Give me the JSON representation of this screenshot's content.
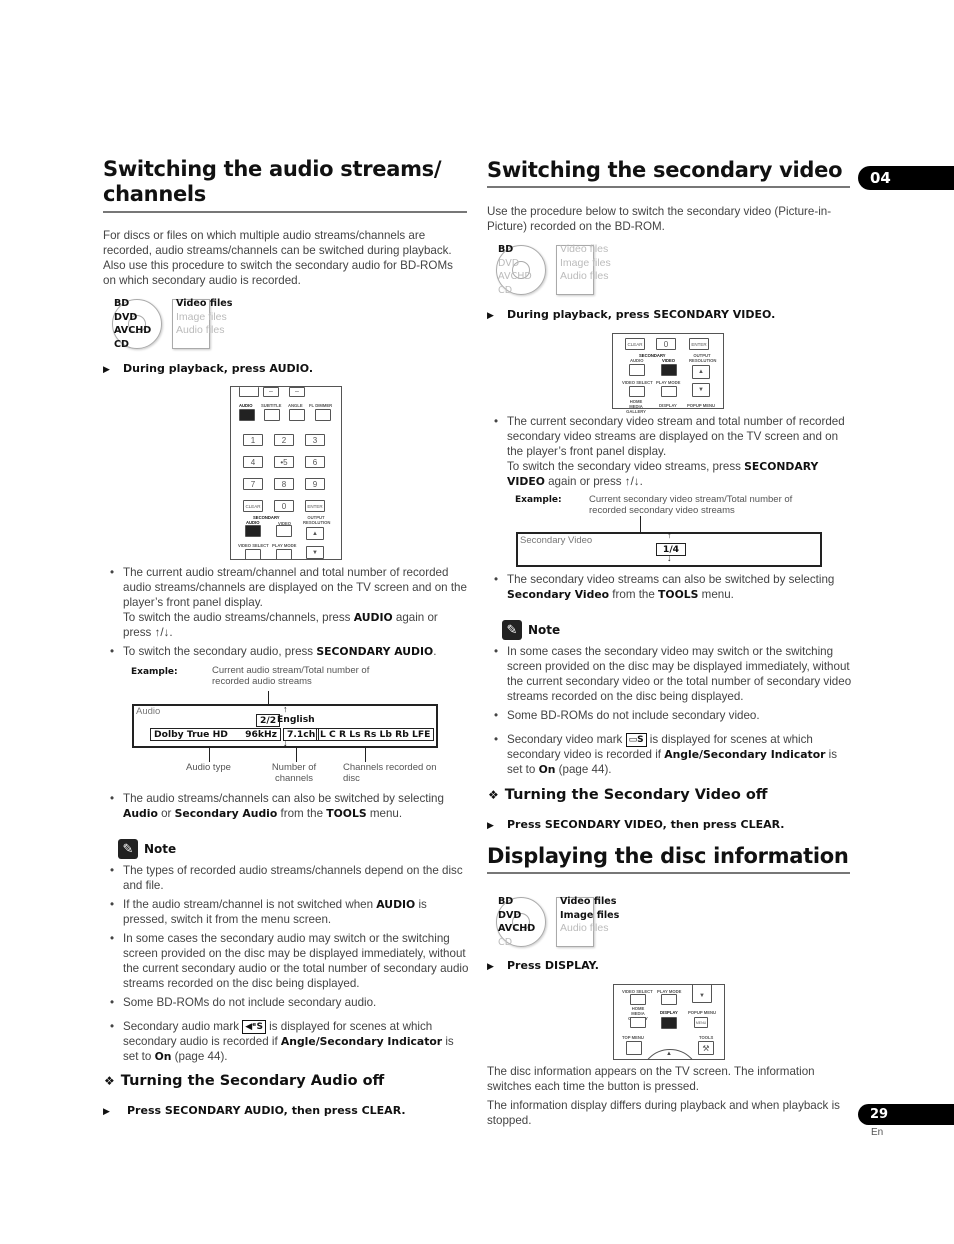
{
  "chapter": "04",
  "page": {
    "number": "29",
    "lang": "En"
  },
  "left": {
    "title_line1": "Switching the audio streams/",
    "title_line2": "channels",
    "intro": "For discs or files on which multiple audio streams/channels are recorded, audio streams/channels can be switched during playback. Also use this procedure to switch the secondary audio for BD-ROMs on which secondary audio is recorded.",
    "media": {
      "discs": [
        {
          "label": "BD",
          "supported": true
        },
        {
          "label": "DVD",
          "supported": true
        },
        {
          "label": "AVCHD",
          "supported": true
        },
        {
          "label": "CD",
          "supported": true
        }
      ],
      "files": [
        {
          "label": "Video files",
          "supported": true
        },
        {
          "label": "Image files",
          "supported": false
        },
        {
          "label": "Audio files",
          "supported": false
        }
      ]
    },
    "step": "During playback, press AUDIO.",
    "remote": {
      "top_labels": [
        "AUDIO",
        "SUBTITLE",
        "ANGLE",
        "FL DIMMER"
      ],
      "digits": [
        "1",
        "2",
        "3",
        "4",
        "•5",
        "6",
        "7",
        "8",
        "9"
      ],
      "clear": "CLEAR",
      "zero": "0",
      "enter": "ENTER",
      "secondary": "SECONDARY",
      "sec_audio": "AUDIO",
      "sec_video": "VIDEO",
      "output_res": "OUTPUT RESOLUTION",
      "video_select": "VIDEO SELECT",
      "play_mode": "PLAY MODE",
      "dash": "–",
      "up": "▲",
      "down": "▼"
    },
    "bullets1": [
      {
        "pre": "The current audio stream/channel and total number of recorded audio streams/channels are displayed on the TV screen and on the player’s front panel display.",
        "line2_pre": "To switch the audio streams/channels, press ",
        "line2_b": "AUDIO",
        "line2_post": " again or press ↑/↓."
      },
      {
        "pre": "To switch the secondary audio, press ",
        "b": "SECONDARY AUDIO",
        "post": "."
      }
    ],
    "example": {
      "label": "Example:",
      "caption": "Current audio stream/Total number of recorded audio streams",
      "osd_title": "Audio",
      "stream": "2/2",
      "language": "English",
      "audio_type": "Dolby True HD",
      "rate": "96kHz",
      "channels": "7.1ch",
      "channel_list": "L C R Ls Rs Lb Rb LFE",
      "cap_type": "Audio type",
      "cap_num": "Number of channels",
      "cap_rec": "Channels recorded on disc"
    },
    "bullet2": {
      "pre": "The audio streams/channels can also be switched by selecting ",
      "b1": "Audio",
      "mid1": " or ",
      "b2": "Secondary Audio",
      "mid2": " from the ",
      "b3": "TOOLS",
      "post": " menu."
    },
    "note": {
      "heading": "Note",
      "items": [
        {
          "text": "The types of recorded audio streams/channels depend on the disc and file."
        },
        {
          "pre": "If the audio stream/channel is not switched when ",
          "b": "AUDIO",
          "post": " is pressed, switch it from the menu screen."
        },
        {
          "text": "In some cases the secondary audio may switch or the switching screen provided on the disc may be displayed immediately, without the current secondary audio or the total number of secondary audio streams recorded on the disc being displayed."
        },
        {
          "text": "Some BD-ROMs do not include secondary audio."
        },
        {
          "pre": "Secondary audio mark ",
          "mark": "◀ᵉS",
          "mid": " is displayed for scenes at which secondary audio is recorded if ",
          "b": "Angle/Secondary Indicator",
          "mid2": " is set to ",
          "b2": "On",
          "post": " (page 44)."
        }
      ]
    },
    "sub_heading": "Turning the Secondary Audio off",
    "sub_step": "Press SECONDARY AUDIO, then press CLEAR."
  },
  "right": {
    "title": "Switching the secondary video",
    "intro": "Use the procedure below to switch the secondary video (Picture-in-Picture) recorded on the BD-ROM.",
    "media": {
      "discs": [
        {
          "label": "BD",
          "supported": true
        },
        {
          "label": "DVD",
          "supported": false
        },
        {
          "label": "AVCHD",
          "supported": false
        },
        {
          "label": "CD",
          "supported": false
        }
      ],
      "files": [
        {
          "label": "Video files",
          "supported": false
        },
        {
          "label": "Image files",
          "supported": false
        },
        {
          "label": "Audio files",
          "supported": false
        }
      ]
    },
    "step": "During playback, press SECONDARY VIDEO.",
    "remote": {
      "clear": "CLEAR",
      "zero": "0",
      "enter": "ENTER",
      "secondary": "SECONDARY",
      "sec_audio": "AUDIO",
      "sec_video": "VIDEO",
      "output_res": "OUTPUT RESOLUTION",
      "video_select": "VIDEO SELECT",
      "play_mode": "PLAY MODE",
      "home_media": "HOME MEDIA GALLERY",
      "display": "DISPLAY",
      "popup": "POPUP MENU",
      "up": "▲",
      "down": "▼"
    },
    "bullet1": {
      "pre": "The current secondary video stream and total number of recorded secondary video streams are displayed on the TV screen and on the player’s front panel display.",
      "line2_pre": "To switch the secondary video streams, press ",
      "line2_b": "SECONDARY VIDEO",
      "line2_post": " again or press ↑/↓."
    },
    "example": {
      "label": "Example:",
      "caption": "Current secondary video stream/Total number of recorded secondary video streams",
      "osd_title": "Secondary Video",
      "stream": "1/4"
    },
    "bullet2": {
      "pre": "The secondary video streams can also be switched by selecting ",
      "b1": "Secondary Video",
      "mid": " from the ",
      "b2": "TOOLS",
      "post": " menu."
    },
    "note": {
      "heading": "Note",
      "items": [
        {
          "text": "In some cases the secondary video may switch or the switching screen provided on the disc may be displayed immediately, without the current secondary video or the total number of secondary video streams recorded on the disc being displayed."
        },
        {
          "text": "Some BD-ROMs do not include secondary video."
        },
        {
          "pre": "Secondary video mark ",
          "mark": "▭S",
          "mid": " is displayed for scenes at which secondary video is recorded if ",
          "b": "Angle/Secondary Indicator",
          "mid2": " is set to ",
          "b2": "On",
          "post": " (page 44)."
        }
      ]
    },
    "sub_heading": "Turning the Secondary Video off",
    "sub_step": "Press SECONDARY VIDEO, then press CLEAR.",
    "disc_info": {
      "title": "Displaying the disc information",
      "media": {
        "discs": [
          {
            "label": "BD",
            "supported": true
          },
          {
            "label": "DVD",
            "supported": true
          },
          {
            "label": "AVCHD",
            "supported": true
          },
          {
            "label": "CD",
            "supported": false
          }
        ],
        "files": [
          {
            "label": "Video files",
            "supported": true
          },
          {
            "label": "Image files",
            "supported": true
          },
          {
            "label": "Audio files",
            "supported": false
          }
        ]
      },
      "step": "Press DISPLAY.",
      "remote": {
        "video_select": "VIDEO SELECT",
        "play_mode": "PLAY MODE",
        "home_media": "HOME MEDIA GALLERY",
        "display": "DISPLAY",
        "popup": "POPUP MENU",
        "menu": "MENU",
        "top_menu": "TOP MENU",
        "tools": "TOOLS",
        "down": "▼",
        "up": "▲"
      },
      "para1": "The disc information appears on the TV screen. The information switches each time the button is pressed.",
      "para2": "The information display differs during playback and when playback is stopped."
    }
  }
}
